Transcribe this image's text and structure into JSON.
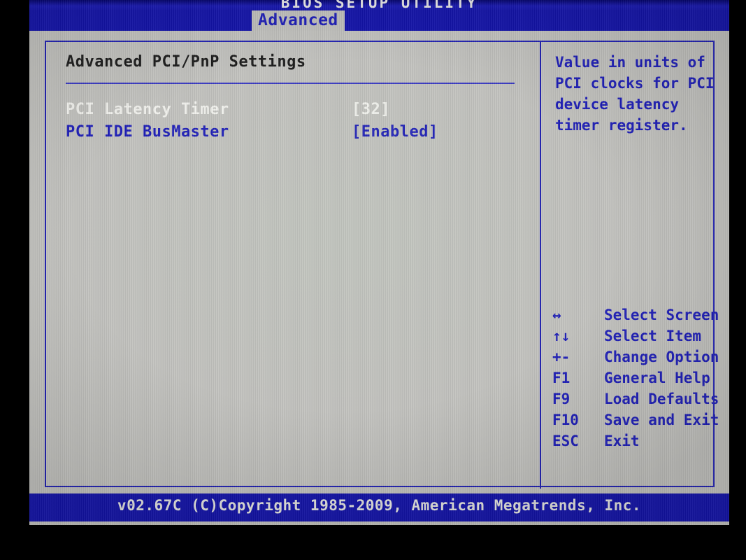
{
  "window": {
    "title": "BIOS SETUP UTILITY",
    "footer": "v02.67C  (C)Copyright 1985-2009, American Megatrends, Inc."
  },
  "menubar": {
    "active_tab": "Advanced"
  },
  "main": {
    "section_title": "Advanced PCI/PnP Settings",
    "settings": [
      {
        "label": "PCI Latency Timer",
        "value": "[32]",
        "selected": true
      },
      {
        "label": "PCI IDE BusMaster",
        "value": "[Enabled]",
        "selected": false
      }
    ]
  },
  "help": {
    "text": "Value in units of PCI clocks for PCI device latency timer register.",
    "lines": [
      "Value in units of PCI",
      "clocks for PCI device",
      "latency timer",
      "register."
    ]
  },
  "legend": [
    {
      "key": "↔",
      "desc": "Select Screen",
      "icon": "left-right-arrow-icon"
    },
    {
      "key": "↑↓",
      "desc": "Select Item",
      "icon": "up-down-arrow-icon"
    },
    {
      "key": "+-",
      "desc": "Change Option",
      "icon": "plus-minus-icon"
    },
    {
      "key": "F1",
      "desc": "General Help",
      "icon": "f1-key-icon"
    },
    {
      "key": "F9",
      "desc": "Load Defaults",
      "icon": "f9-key-icon"
    },
    {
      "key": "F10",
      "desc": "Save and Exit",
      "icon": "f10-key-icon"
    },
    {
      "key": "ESC",
      "desc": "Exit",
      "icon": "esc-key-icon"
    }
  ],
  "colors": {
    "bar_blue": "#1414ab",
    "text_blue": "#1f1fb8",
    "screen_gray": "#c3c3bf",
    "selected_white": "#f2f2ee",
    "frame_blue": "#2222b4",
    "bezel_black": "#000000"
  }
}
